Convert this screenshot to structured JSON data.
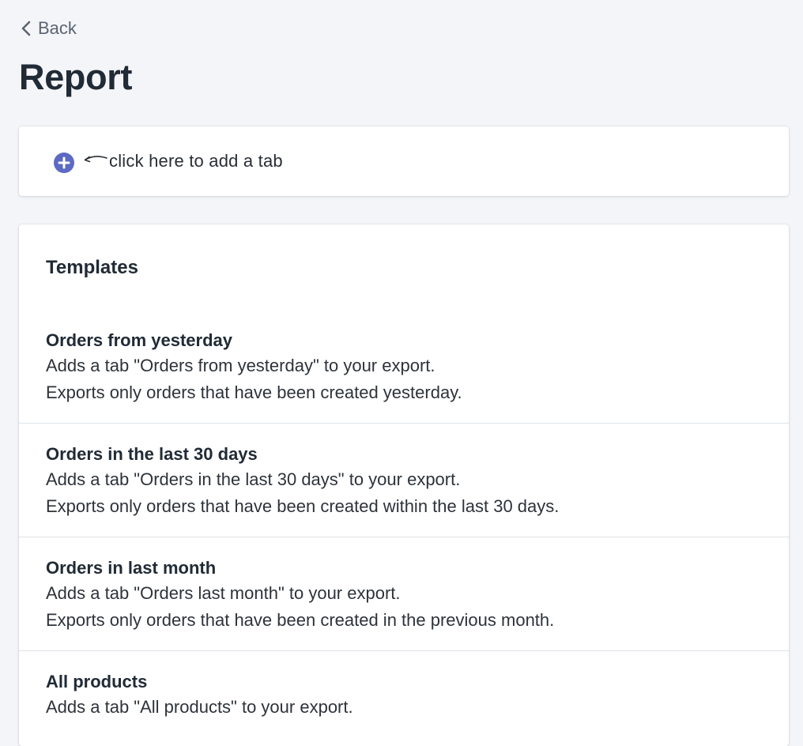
{
  "back": {
    "label": "Back",
    "icon": "chevron-left-icon"
  },
  "page": {
    "title": "Report"
  },
  "add_tab": {
    "icon": "plus-circle-icon",
    "hint": "click here to add a tab"
  },
  "templates": {
    "heading": "Templates",
    "items": [
      {
        "title": "Orders from yesterday",
        "line1": "Adds a tab \"Orders from yesterday\" to your export.",
        "line2": "Exports only orders that have been created yesterday."
      },
      {
        "title": "Orders in the last 30 days",
        "line1": "Adds a tab \"Orders in the last 30 days\" to your export.",
        "line2": "Exports only orders that have been created within the last 30 days."
      },
      {
        "title": "Orders in last month",
        "line1": "Adds a tab \"Orders last month\" to your export.",
        "line2": "Exports only orders that have been created in the previous month."
      },
      {
        "title": "All products",
        "line1": "Adds a tab \"All products\" to your export.",
        "line2": ""
      }
    ]
  },
  "colors": {
    "background": "#f4f5f9",
    "accent": "#5c6ac4",
    "text": "#212b36",
    "divider": "#dfe3e8"
  }
}
